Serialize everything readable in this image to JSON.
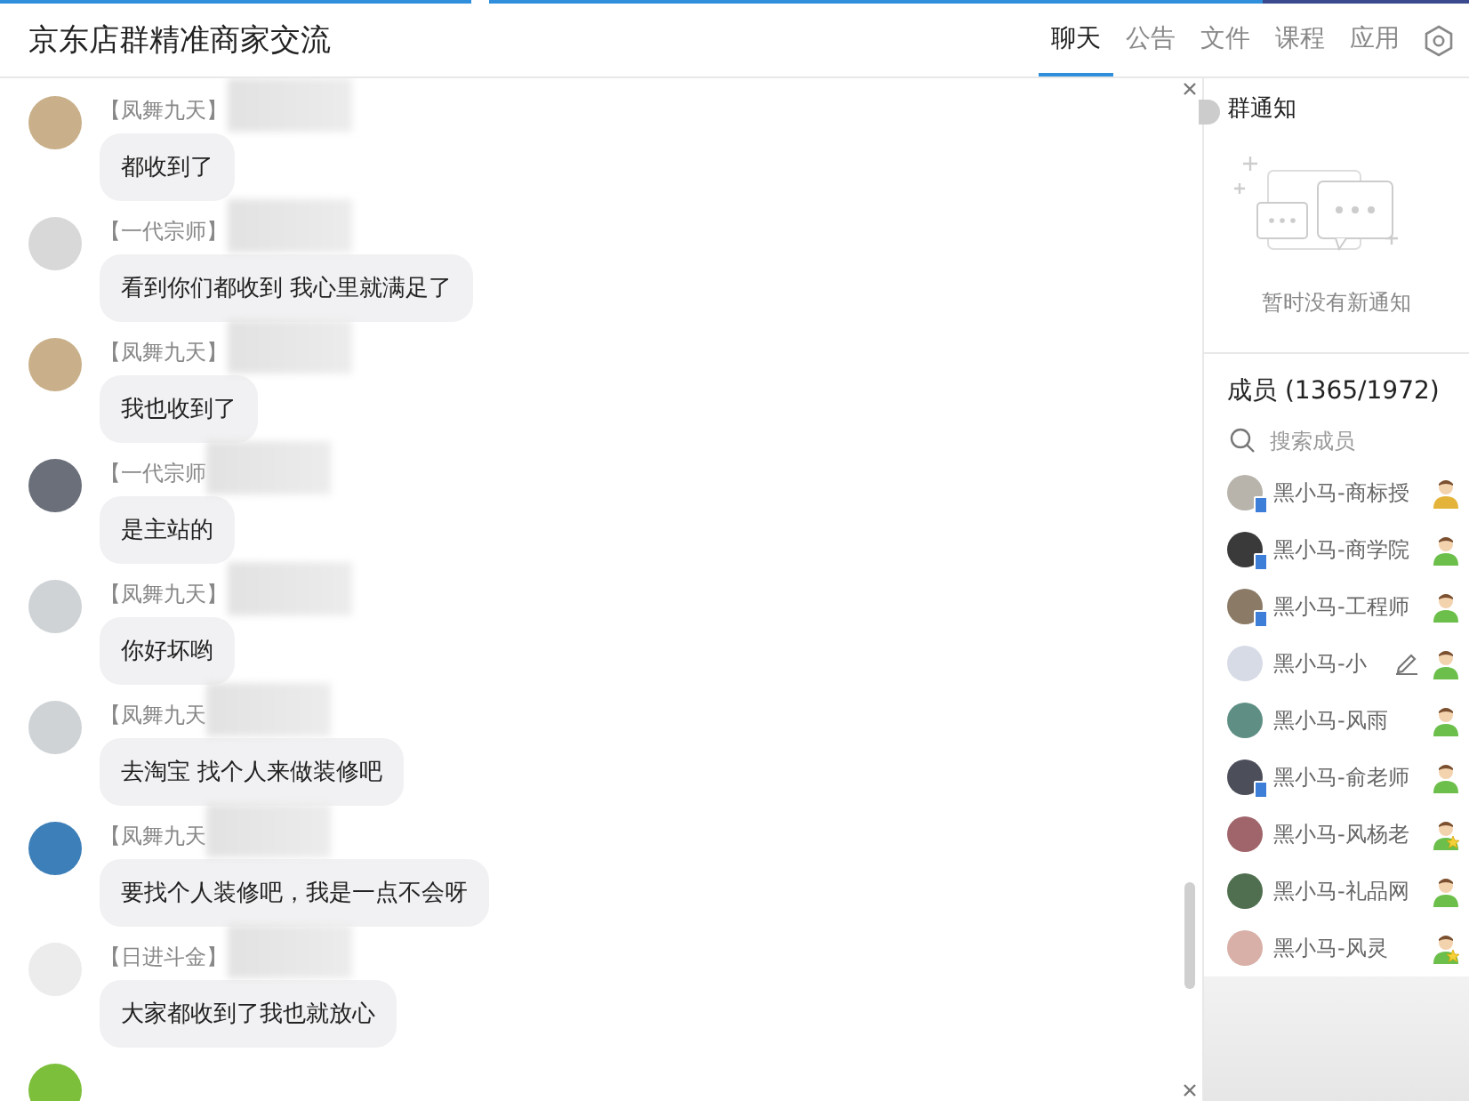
{
  "window": {
    "title": "京东店群精准商家交流"
  },
  "tabs": [
    {
      "label": "聊天",
      "selected": true
    },
    {
      "label": "公告",
      "selected": false
    },
    {
      "label": "文件",
      "selected": false
    },
    {
      "label": "课程",
      "selected": false
    },
    {
      "label": "应用",
      "selected": false
    }
  ],
  "messages": [
    {
      "sender": "【凤舞九天】",
      "text": "都收到了"
    },
    {
      "sender": "【一代宗师】",
      "text": "看到你们都收到 我心里就满足了"
    },
    {
      "sender": "【凤舞九天】",
      "text": "我也收到了"
    },
    {
      "sender": "【一代宗师",
      "text": "是主站的"
    },
    {
      "sender": "【凤舞九天】",
      "text": "你好坏哟"
    },
    {
      "sender": "【凤舞九天",
      "text": "去淘宝 找个人来做装修吧"
    },
    {
      "sender": "【凤舞九天",
      "text": "要找个人装修吧，我是一点不会呀"
    },
    {
      "sender": "【日进斗金】",
      "text": "大家都收到了我也就放心"
    }
  ],
  "notice": {
    "title": "群通知",
    "empty_text": "暂时没有新通知"
  },
  "members": {
    "title": "成员 (1365/1972)",
    "search": {
      "placeholder": "搜索成员"
    },
    "items": [
      {
        "name": "黑小马-商标授",
        "kind": "owner",
        "mobile": true
      },
      {
        "name": "黑小马-商学院",
        "kind": "member",
        "mobile": true
      },
      {
        "name": "黑小马-工程师",
        "kind": "member",
        "mobile": true
      },
      {
        "name": "黑小马-小",
        "kind": "member",
        "mobile": false,
        "editing": true
      },
      {
        "name": "黑小马-风雨",
        "kind": "member",
        "mobile": false
      },
      {
        "name": "黑小马-俞老师",
        "kind": "member",
        "mobile": true
      },
      {
        "name": "黑小马-风杨老",
        "kind": "admin",
        "mobile": false
      },
      {
        "name": "黑小马-礼品网",
        "kind": "member",
        "mobile": false
      },
      {
        "name": "黑小马-风灵",
        "kind": "admin",
        "mobile": false
      }
    ]
  }
}
